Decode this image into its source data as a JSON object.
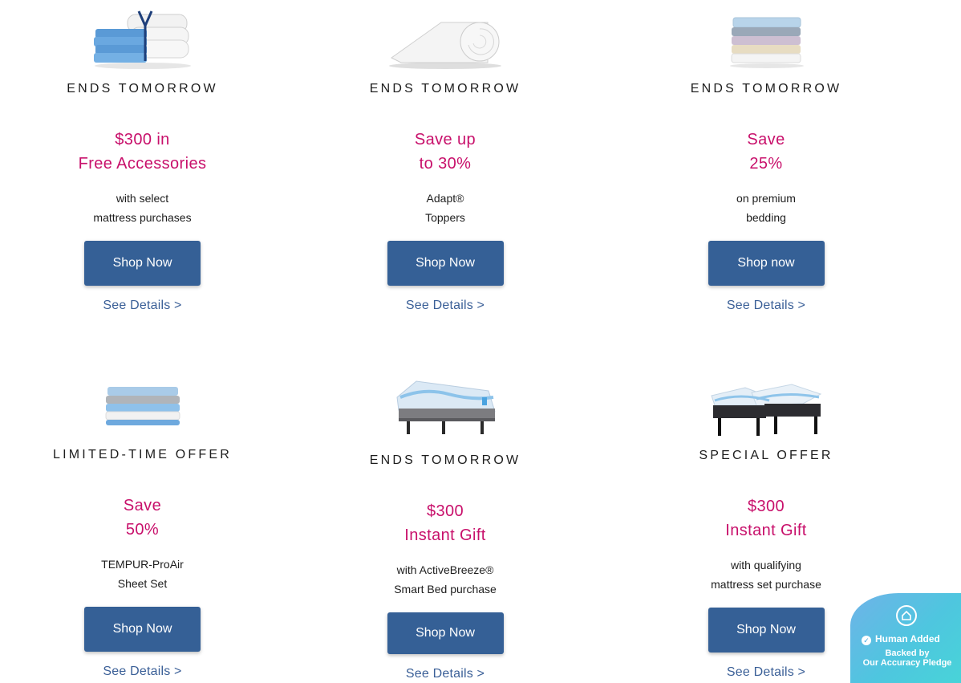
{
  "promos": [
    {
      "eyebrow": "ENDS TOMORROW",
      "headline1": "$300 in",
      "headline2": "Free Accessories",
      "sub1": "with select",
      "sub2": "mattress purchases",
      "button": "Shop Now",
      "details": "See Details >",
      "image": "pillows-sheets-bundle"
    },
    {
      "eyebrow": "ENDS TOMORROW",
      "headline1": "Save up",
      "headline2": "to 30%",
      "sub1": "Adapt®",
      "sub2": "Toppers",
      "button": "Shop Now",
      "details": "See Details >",
      "image": "rolled-topper"
    },
    {
      "eyebrow": "ENDS TOMORROW",
      "headline1": "Save",
      "headline2": "25%",
      "sub1": "on premium",
      "sub2": "bedding",
      "button": "Shop now",
      "details": "See Details >",
      "image": "folded-sheets-stack"
    },
    {
      "eyebrow": "LIMITED-TIME OFFER",
      "headline1": "Save",
      "headline2": "50%",
      "sub1": "TEMPUR-ProAir",
      "sub2": "Sheet Set",
      "button": "Shop Now",
      "details": "See Details >",
      "image": "folded-sheet-set"
    },
    {
      "eyebrow": "ENDS TOMORROW",
      "headline1": "$300",
      "headline2": "Instant Gift",
      "sub1": "with ActiveBreeze®",
      "sub2": "Smart Bed purchase",
      "button": "Shop Now",
      "details": "See Details >",
      "image": "adjustable-smart-bed"
    },
    {
      "eyebrow": "SPECIAL OFFER",
      "headline1": "$300",
      "headline2": "Instant Gift",
      "sub1": "with qualifying",
      "sub2": "mattress set purchase",
      "button": "Shop Now",
      "details": "See Details >",
      "image": "split-adjustable-bed"
    }
  ],
  "badge": {
    "title": "Human Added",
    "line2": "Backed by",
    "line3": "Our Accuracy Pledge",
    "icon": "home-icon"
  },
  "colors": {
    "headline": "#c8106b",
    "button": "#356096",
    "link": "#3a5f97"
  }
}
